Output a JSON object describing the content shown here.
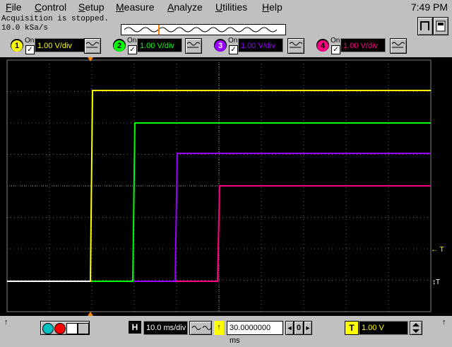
{
  "menu": {
    "items": [
      "File",
      "Control",
      "Setup",
      "Measure",
      "Analyze",
      "Utilities",
      "Help"
    ],
    "clock": "7:49 PM"
  },
  "status": {
    "acquisition": "Acquisition is stopped.",
    "sample_rate": "10.0 kSa/s"
  },
  "channels": [
    {
      "number": "1",
      "on_label": "On",
      "checked": "✓",
      "scale": "1.00 V/div",
      "color": "#ffff00"
    },
    {
      "number": "2",
      "on_label": "On",
      "checked": "✓",
      "scale": "1.00 V/div",
      "color": "#00ff00"
    },
    {
      "number": "3",
      "on_label": "On",
      "checked": "✓",
      "scale": "1.00 V/div",
      "color": "#9900ff"
    },
    {
      "number": "4",
      "on_label": "On",
      "checked": "✓",
      "scale": "1.00 V/div",
      "color": "#ff0080"
    }
  ],
  "scope": {
    "trigger_level_label": "← T",
    "trigger_marker_label": "↕T",
    "grid": true
  },
  "bottom": {
    "horizontal_letter": "H",
    "time_per_div": "10.0 ms/div",
    "delay": "30.0000000 ms",
    "delay_arrow_left": "◄",
    "delay_zero": "0",
    "delay_arrow_right": "►",
    "trigger_letter": "T",
    "trigger_level": "1.00 V",
    "up_arrow": "↑"
  }
}
